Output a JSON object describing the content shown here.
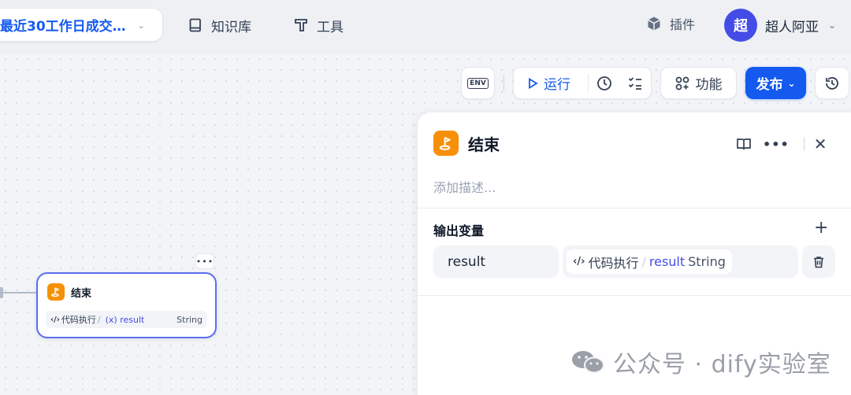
{
  "app": {
    "name": "最近30工作日成交…"
  },
  "nav": {
    "knowledge": "知识库",
    "tools": "工具",
    "plugins": "插件"
  },
  "user": {
    "avatar_char": "超",
    "name": "超人阿亚"
  },
  "toolbar": {
    "env": "ENV",
    "run": "运行",
    "features": "功能",
    "publish": "发布"
  },
  "node": {
    "title": "结束",
    "source": "代码执行",
    "separator": "/",
    "variable": "(x) result",
    "type": "String"
  },
  "panel": {
    "title": "结束",
    "description_placeholder": "添加描述...",
    "output_label": "输出变量",
    "output": {
      "name": "result",
      "source": "代码执行",
      "separator": "/",
      "variable": "result",
      "type": "String"
    }
  },
  "watermark": {
    "text": "公众号 · dify实验室"
  },
  "colors": {
    "accent": "#155aef",
    "end_node": "#f79009",
    "avatar": "#444ce7",
    "node_border": "#5a6ef0"
  }
}
